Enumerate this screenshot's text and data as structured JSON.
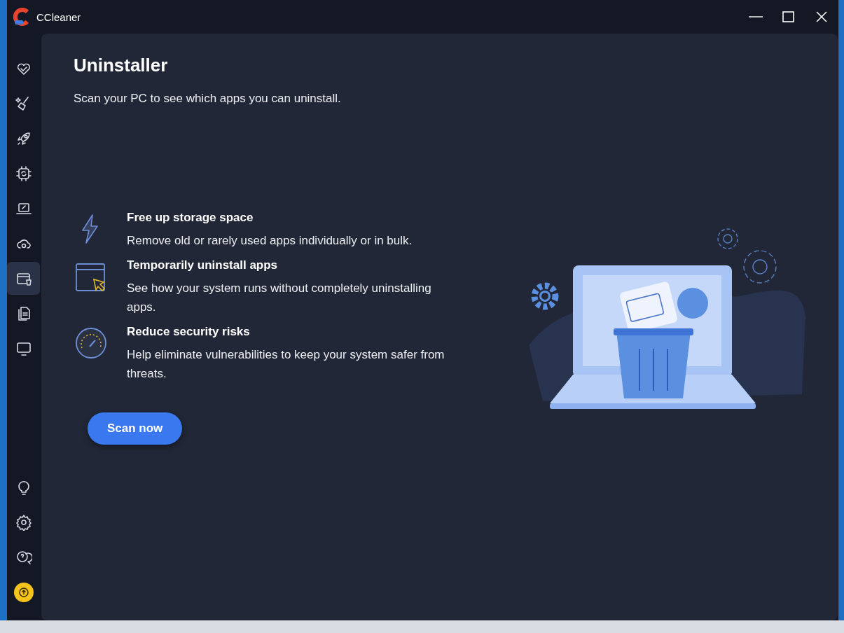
{
  "window": {
    "title": "CCleaner"
  },
  "sidebar": {
    "items": [
      {
        "selected": false
      },
      {
        "selected": false
      },
      {
        "selected": false
      },
      {
        "selected": false
      },
      {
        "selected": false
      },
      {
        "selected": false
      },
      {
        "selected": true
      },
      {
        "selected": false
      },
      {
        "selected": false
      }
    ]
  },
  "main": {
    "title": "Uninstaller",
    "subtitle": "Scan your PC to see which apps you can uninstall.",
    "features": [
      {
        "title": "Free up storage space",
        "description": "Remove old or rarely used apps individually or in bulk."
      },
      {
        "title": "Temporarily uninstall apps",
        "description": "See how your system runs without completely uninstalling apps."
      },
      {
        "title": "Reduce security risks",
        "description": "Help eliminate vulnerabilities to keep your system safer from threats."
      }
    ],
    "button": "Scan now"
  }
}
